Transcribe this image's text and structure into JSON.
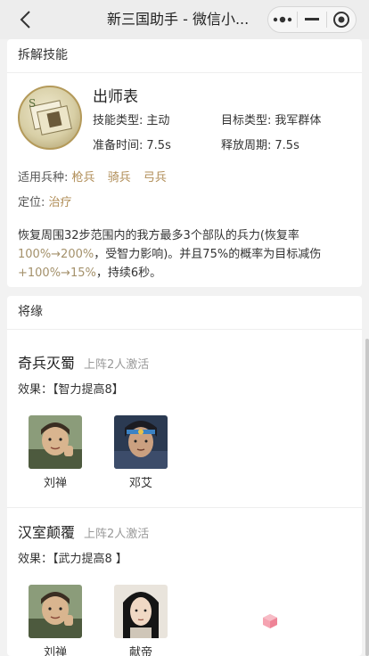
{
  "navbar": {
    "title": "新三国助手 - 微信小...",
    "back_icon": "chevron-left-icon",
    "more_icon": "more-dots-icon",
    "minimize_icon": "minimize-icon",
    "close_icon": "target-circle-icon"
  },
  "skill_section": {
    "header": "拆解技能",
    "name": "出师表",
    "skill_type_label": "技能类型:",
    "skill_type_value": "主动",
    "target_type_label": "目标类型:",
    "target_type_value": "我军群体",
    "prepare_label": "准备时间:",
    "prepare_value": "7.5s",
    "cooldown_label": "释放周期:",
    "cooldown_value": "7.5s",
    "units_label": "适用兵种:",
    "units": [
      "枪兵",
      "骑兵",
      "弓兵"
    ],
    "role_label": "定位:",
    "role_value": "治疗",
    "desc": {
      "p1": "恢复周围32步范围内的我方最多3个部队的兵力(恢复率",
      "h1": "100%→200%",
      "p2": "，受智力影响)。并且75%的概率为目标减伤",
      "h2": "+100%→15%",
      "p3": "，持续6秒。"
    }
  },
  "fate_section": {
    "header": "将缘",
    "fates": [
      {
        "title": "奇兵灭蜀",
        "condition": "上阵2人激活",
        "effect": "效果：【智力提高8】",
        "heroes": [
          {
            "name": "刘禅"
          },
          {
            "name": "邓艾"
          }
        ]
      },
      {
        "title": "汉室颠覆",
        "condition": "上阵2人激活",
        "effect": "效果：【武力提高8 】",
        "heroes": [
          {
            "name": "刘禅"
          },
          {
            "name": "献帝"
          }
        ]
      }
    ]
  },
  "colors": {
    "accent_gold": "#b08d57",
    "highlight": "#a4916b",
    "fab_pink": "#f28fa0"
  }
}
